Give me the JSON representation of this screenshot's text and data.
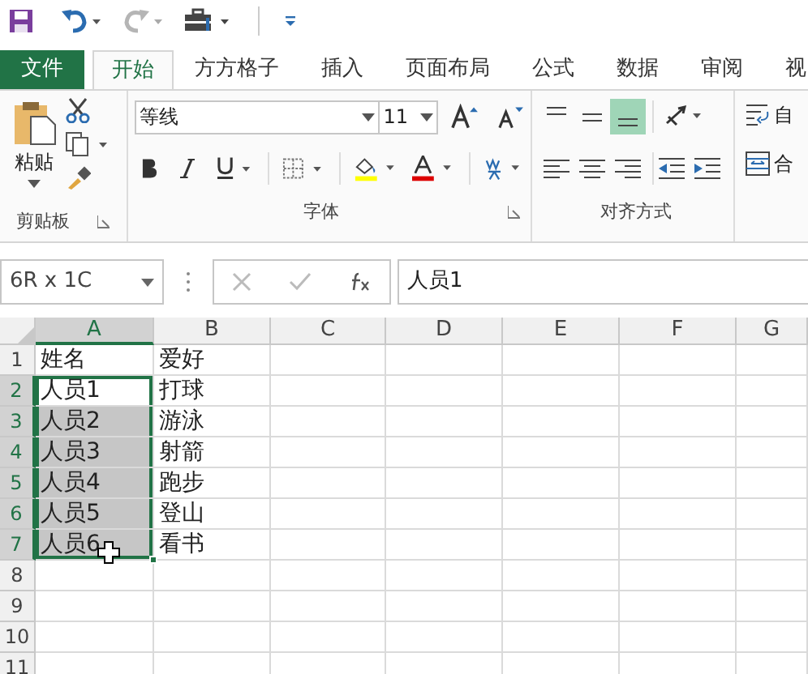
{
  "tabs": [
    {
      "label": "文件",
      "kind": "file",
      "selected": false
    },
    {
      "label": "开始",
      "kind": "tab",
      "selected": true
    },
    {
      "label": "方方格子",
      "kind": "tab",
      "selected": false
    },
    {
      "label": "插入",
      "kind": "tab",
      "selected": false
    },
    {
      "label": "页面布局",
      "kind": "tab",
      "selected": false
    },
    {
      "label": "公式",
      "kind": "tab",
      "selected": false
    },
    {
      "label": "数据",
      "kind": "tab",
      "selected": false
    },
    {
      "label": "审阅",
      "kind": "tab",
      "selected": false
    },
    {
      "label": "视",
      "kind": "tab",
      "selected": false
    }
  ],
  "ribbon": {
    "paste_label": "粘贴",
    "font_name": "等线",
    "font_size": "11",
    "wrap_label": "自",
    "merge_label": "合",
    "vertical_align": [
      {
        "selected": false
      },
      {
        "selected": false
      },
      {
        "selected": true
      }
    ],
    "groups": [
      "剪贴板",
      "字体",
      "对齐方式"
    ]
  },
  "name_box": "6R x 1C",
  "formula": "人员1",
  "columns": [
    {
      "label": "A",
      "selected": true
    },
    {
      "label": "B",
      "selected": false
    },
    {
      "label": "C",
      "selected": false
    },
    {
      "label": "D",
      "selected": false
    },
    {
      "label": "E",
      "selected": false
    },
    {
      "label": "F",
      "selected": false
    },
    {
      "label": "G",
      "selected": false
    }
  ],
  "rows": [
    {
      "number": "1",
      "selected": false,
      "cells": [
        {
          "text": "姓名",
          "selected": false,
          "active": false
        },
        {
          "text": "爱好",
          "selected": false,
          "active": false
        }
      ]
    },
    {
      "number": "2",
      "selected": true,
      "cells": [
        {
          "text": "人员1",
          "selected": true,
          "active": true
        },
        {
          "text": "打球",
          "selected": false,
          "active": false
        }
      ]
    },
    {
      "number": "3",
      "selected": true,
      "cells": [
        {
          "text": "人员2",
          "selected": true,
          "active": false
        },
        {
          "text": "游泳",
          "selected": false,
          "active": false
        }
      ]
    },
    {
      "number": "4",
      "selected": true,
      "cells": [
        {
          "text": "人员3",
          "selected": true,
          "active": false
        },
        {
          "text": "射箭",
          "selected": false,
          "active": false
        }
      ]
    },
    {
      "number": "5",
      "selected": true,
      "cells": [
        {
          "text": "人员4",
          "selected": true,
          "active": false
        },
        {
          "text": "跑步",
          "selected": false,
          "active": false
        }
      ]
    },
    {
      "number": "6",
      "selected": true,
      "cells": [
        {
          "text": "人员5",
          "selected": true,
          "active": false
        },
        {
          "text": "登山",
          "selected": false,
          "active": false
        }
      ]
    },
    {
      "number": "7",
      "selected": true,
      "cells": [
        {
          "text": "人员6",
          "selected": true,
          "active": false
        },
        {
          "text": "看书",
          "selected": false,
          "active": false
        }
      ]
    },
    {
      "number": "8",
      "selected": false
    },
    {
      "number": "9",
      "selected": false
    },
    {
      "number": "10",
      "selected": false
    },
    {
      "number": "11",
      "selected": false
    }
  ]
}
